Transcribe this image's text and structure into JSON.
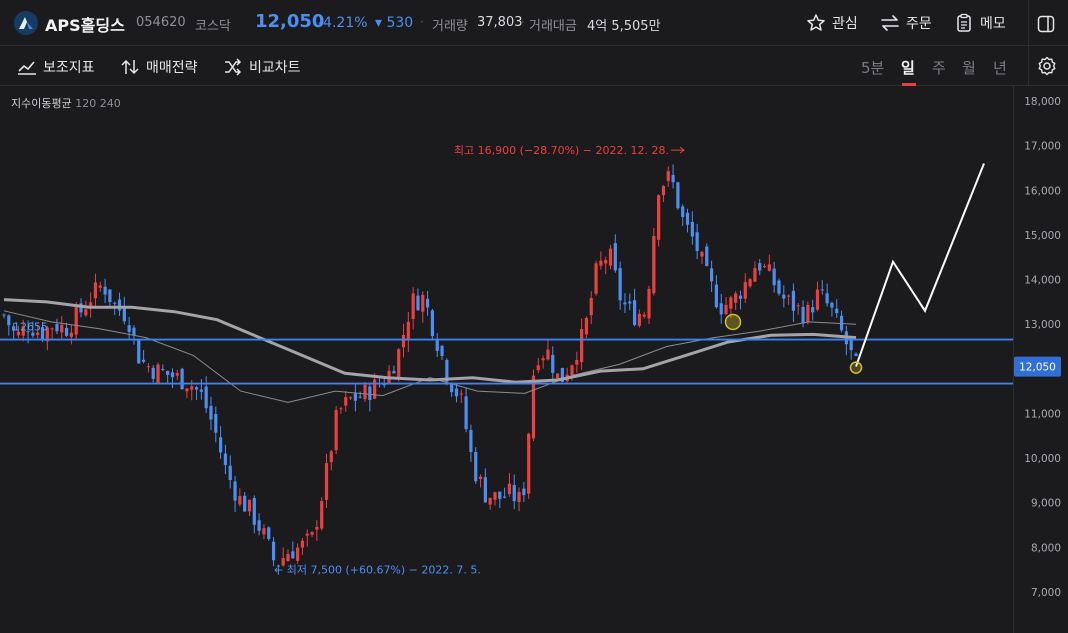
{
  "header": {
    "stock_name": "APS홀딩스",
    "stock_code": "054620",
    "market": "코스닥",
    "price": "12,050",
    "change_pct": "-4.21%",
    "change_amt": "▾ 530",
    "volume_label": "거래량",
    "volume_value": "37,803",
    "amount_label": "거래대금",
    "amount_value": "4억 5,505만",
    "watch_label": "관심",
    "order_label": "주문",
    "memo_label": "메모",
    "colors": {
      "down": "#4d8ff0",
      "up": "#e8413f"
    }
  },
  "toolbar": {
    "indicators_label": "보조지표",
    "strategy_label": "매매전략",
    "compare_label": "비교차트",
    "periods": [
      "5분",
      "일",
      "주",
      "월",
      "년"
    ],
    "active_period": "일"
  },
  "indicator": {
    "name": "지수이동평균",
    "params": "120 240"
  },
  "chart_data": {
    "type": "candlestick",
    "y_ticks": [
      "18,000",
      "17,000",
      "16,000",
      "15,000",
      "14,000",
      "13,000",
      "12,000",
      "11,000",
      "10,000",
      "9,000",
      "8,000",
      "7,000"
    ],
    "ylim": [
      6500,
      18300
    ],
    "current_price": 12050,
    "current_price_label": "12,050",
    "high_annotation": "최고 16,900 (−28.70%) − 2022. 12. 28.",
    "low_annotation": "← 최저 7,500 (+60.67%) − 2022. 7. 5.",
    "horizontal_lines": [
      {
        "value": 12655,
        "label": "12655"
      },
      {
        "value": 11670,
        "label": ""
      }
    ],
    "close_path": [
      13200,
      12700,
      13000,
      12800,
      13000,
      12900,
      13200,
      13600,
      13900,
      13400,
      13200,
      12200,
      12000,
      11900,
      11800,
      11700,
      11400,
      10700,
      9700,
      9100,
      8800,
      8300,
      7600,
      7900,
      8000,
      8200,
      9500,
      11000,
      11300,
      11400,
      11600,
      11800,
      12400,
      13500,
      13600,
      12700,
      11800,
      11300,
      9800,
      9200,
      9100,
      9200,
      9000,
      12300,
      12400,
      11700,
      12200,
      12800,
      14200,
      14600,
      13500,
      13200,
      13300,
      16100,
      16300,
      15300,
      14800,
      14000,
      13400,
      13500,
      13900,
      14400,
      14100,
      13600,
      13400,
      13200,
      13700,
      13300,
      12700,
      12050
    ],
    "ema120": [
      13550,
      13500,
      13380,
      13380,
      13280,
      13100,
      12700,
      12300,
      11900,
      11800,
      11750,
      11800,
      11700,
      11750,
      11950,
      12000,
      12300,
      12600,
      12750,
      12770,
      12700
    ],
    "ema240": [
      13300,
      13050,
      12900,
      12700,
      12300,
      11500,
      11250,
      11500,
      11400,
      11800,
      11500,
      11450,
      11850,
      12100,
      12500,
      12700,
      12850,
      13050,
      13000
    ],
    "projection": [
      12050,
      14400,
      13300,
      16600
    ],
    "markers": [
      13050,
      12050
    ],
    "colors": {
      "up": "#e8413f",
      "down": "#4d8ff0",
      "ema120": "#8c8c90",
      "ema240": "#a4a4a8",
      "hline": "#3b82f6",
      "projection": "#ffffff",
      "marker": "#d4c22a"
    }
  }
}
